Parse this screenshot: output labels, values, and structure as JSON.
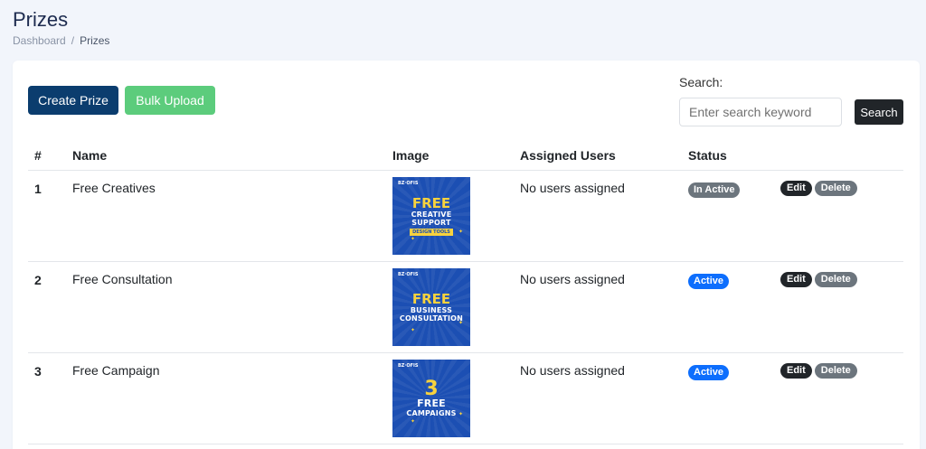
{
  "page": {
    "title": "Prizes",
    "breadcrumb": [
      "Dashboard",
      "Prizes"
    ]
  },
  "toolbar": {
    "create_label": "Create Prize",
    "bulk_label": "Bulk Upload",
    "search_label": "Search:",
    "search_placeholder": "Enter search keyword",
    "search_value": "",
    "search_button": "Search"
  },
  "table": {
    "headers": [
      "#",
      "Name",
      "Image",
      "Assigned Users",
      "Status",
      ""
    ],
    "edit_label": "Edit",
    "delete_label": "Delete",
    "rows": [
      {
        "num": "1",
        "name": "Free Creatives",
        "users": "No users assigned",
        "status": "In Active",
        "image": {
          "brand": "BZ·OFIS",
          "big": "FREE",
          "lines": [
            "CREATIVE",
            "SUPPORT"
          ],
          "tag": "DESIGN TOOLS"
        }
      },
      {
        "num": "2",
        "name": "Free Consultation",
        "users": "No users assigned",
        "status": "Active",
        "image": {
          "brand": "BZ·OFIS",
          "big": "FREE",
          "lines": [
            "BUSINESS",
            "CONSULTATION"
          ],
          "tag": ""
        }
      },
      {
        "num": "3",
        "name": "Free Campaign",
        "users": "No users assigned",
        "status": "Active",
        "image": {
          "brand": "BZ·OFIS",
          "big": "3",
          "lines": [
            "FREE",
            "CAMPAIGNS"
          ],
          "tag": ""
        }
      }
    ]
  },
  "colors": {
    "primary_dark": "#0b3d6e",
    "success": "#5ccc7c",
    "active_badge": "#0d6efd",
    "inactive_badge": "#6c757d",
    "prize_bg": "#1c4fb3",
    "prize_accent": "#f7d23e"
  }
}
